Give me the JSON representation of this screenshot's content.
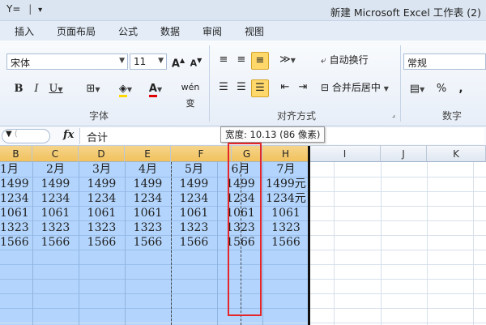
{
  "window": {
    "title": "新建 Microsoft Excel 工作表 (2)",
    "qa_label": "Y="
  },
  "tabs": [
    "插入",
    "页面布局",
    "公式",
    "数据",
    "审阅",
    "视图"
  ],
  "ribbon": {
    "font_name": "宋体",
    "font_size": "11",
    "font_group_label": "字体",
    "align_group_label": "对齐方式",
    "wrap_text": "自动换行",
    "merge_center": "合并后居中",
    "number_format": "常规",
    "number_group_label": "数字",
    "percent": "%",
    "comma": ","
  },
  "formula_bar": {
    "fx": "fx",
    "content": "合计"
  },
  "tooltip": "宽度: 10.13 (86 像素)",
  "columns": [
    "B",
    "C",
    "D",
    "E",
    "F",
    "G",
    "H",
    "I",
    "J",
    "K"
  ],
  "rows": [
    [
      "1月",
      "2月",
      "3月",
      "4月",
      "5月",
      "6月",
      "7月"
    ],
    [
      "1499",
      "1499",
      "1499",
      "1499",
      "1499",
      "1499",
      "1499元"
    ],
    [
      "1234",
      "1234",
      "1234",
      "1234",
      "1234",
      "1234",
      "1234元"
    ],
    [
      "1061",
      "1061",
      "1061",
      "1061",
      "1061",
      "1061",
      "1061"
    ],
    [
      "1323",
      "1323",
      "1323",
      "1323",
      "1323",
      "1323",
      "1323"
    ],
    [
      "1566",
      "1566",
      "1566",
      "1566",
      "1566",
      "1566",
      "1566"
    ]
  ],
  "colors": {
    "selection": "#b3d5fd",
    "highlight": "#e4262a",
    "ribbon_accent": "#ffd86b"
  }
}
